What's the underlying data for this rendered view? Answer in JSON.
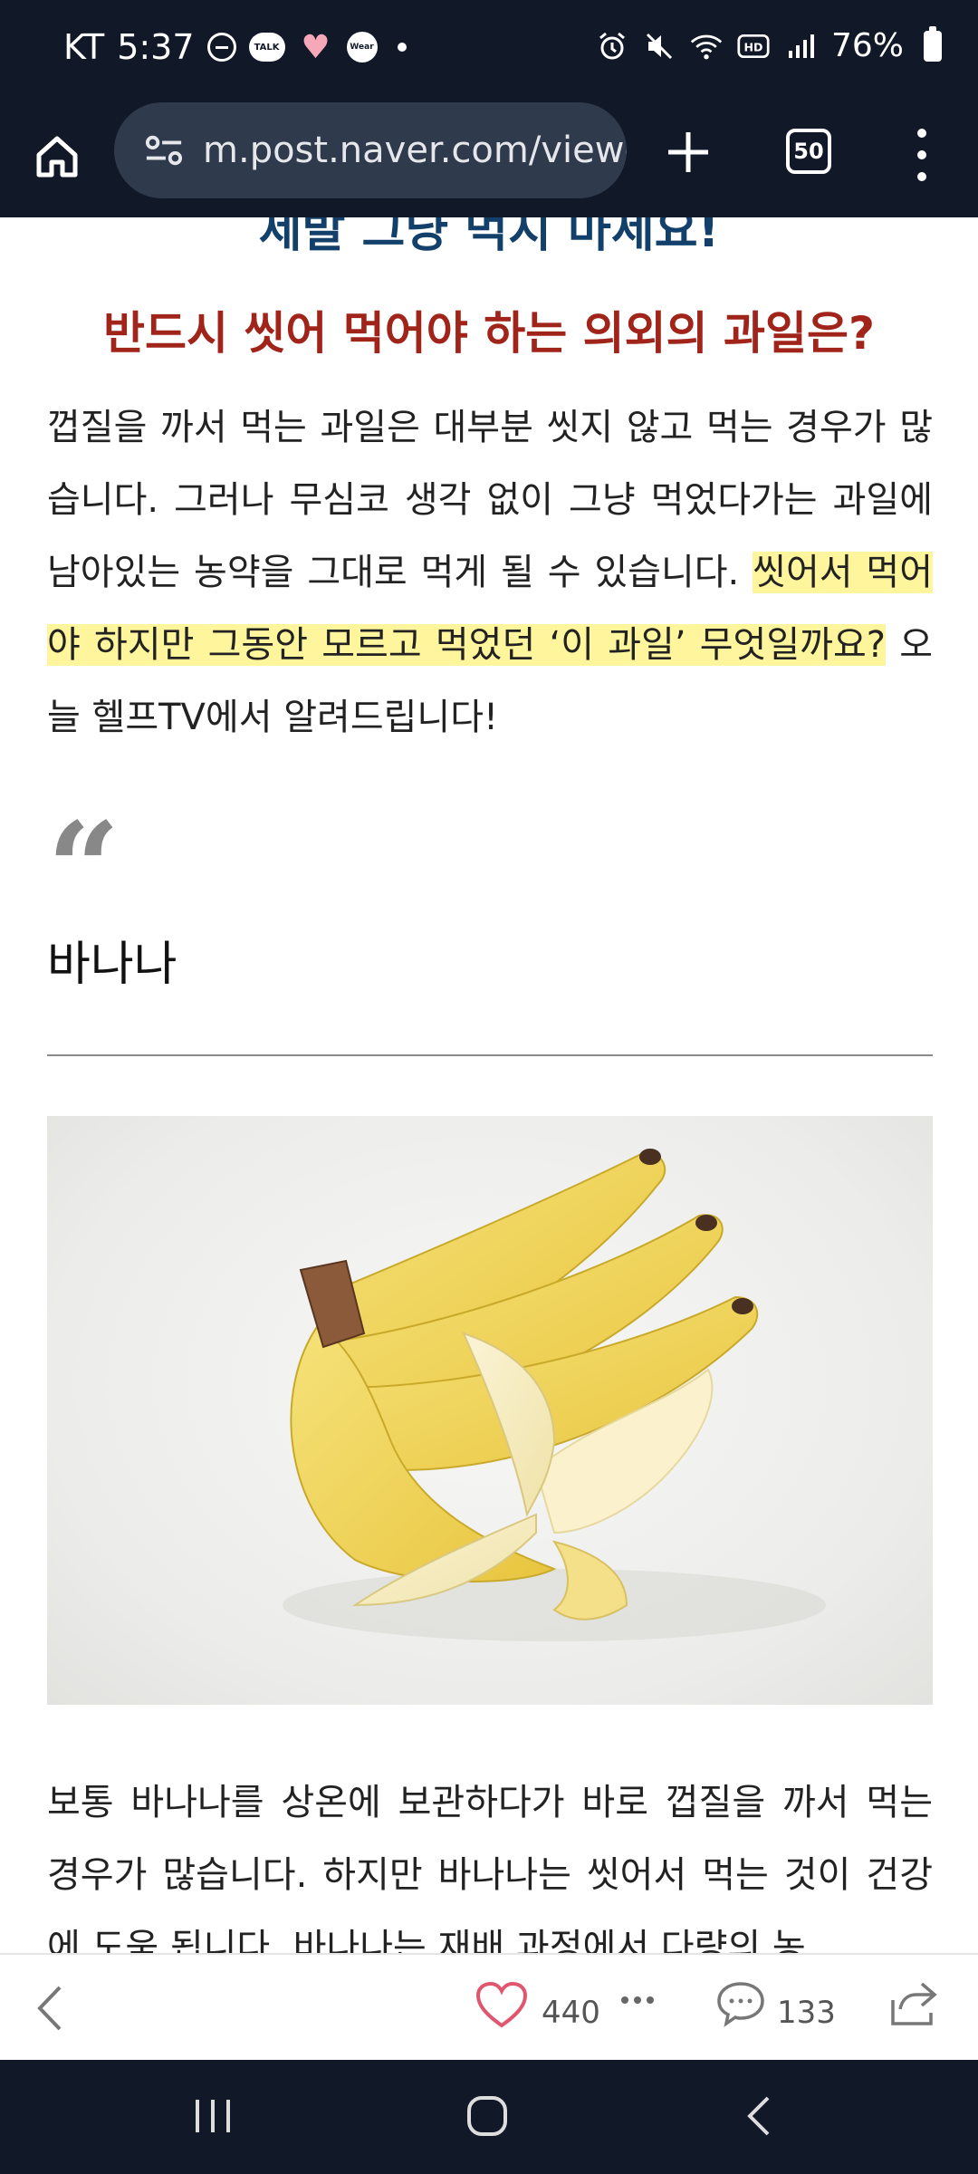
{
  "status_bar": {
    "carrier": "KT",
    "time": "5:37",
    "battery": "76%",
    "icons_left": [
      "do-not-disturb-icon",
      "kakaotalk-icon",
      "heart-icon",
      "wear-icon",
      "dot-icon"
    ],
    "icons_right": [
      "alarm-icon",
      "mute-icon",
      "wifi-icon",
      "hd-voice-icon",
      "signal-icon",
      "battery-icon"
    ],
    "talk_label": "TALK",
    "wear_label": "Wear"
  },
  "browser": {
    "url": "m.post.naver.com/viewe",
    "tab_count": "50",
    "home_icon": "home-icon",
    "site_settings_icon": "tune-icon",
    "new_tab_icon": "plus-icon",
    "menu_icon": "more-vert-icon"
  },
  "article": {
    "headline_1": "제발 그냥 먹지 마세요!",
    "headline_2": "반드시 씻어 먹어야 하는 의외의 과일은?",
    "intro_plain": "껍질을 까서 먹는 과일은 대부분 씻지 않고 먹는 경우가 많습니다. 그러나 무심코 생각 없이 그냥 먹었다가는 과일에 남아있는 농약을 그대로 먹게  될 수 있습니다. ",
    "intro_highlight": "씻어서 먹어야 하지만 그동안 모르고 먹었던 ‘이 과일’ 무엇일까요?",
    "intro_tail": " 오늘 헬프TV에서 알려드립니다!",
    "quote_mark": "“",
    "section_title": "바나나",
    "body_text": "보통 바나나를 상온에 보관하다가 바로 껍질을 까서 먹는  경우가 많습니다. 하지만 바나나는 씻어서 먹는 것이 건강에 도움 됩니다. 바나나는 재배 과정에서 다량의 농"
  },
  "action_bar": {
    "like_count": "440",
    "comment_count": "133"
  },
  "colors": {
    "system_bar": "#111827",
    "url_box": "#2f3a4d",
    "headline_blue": "#12406b",
    "headline_red": "#a1241a",
    "highlight": "#fff59d",
    "banana_yellow": "#f2d65a"
  }
}
